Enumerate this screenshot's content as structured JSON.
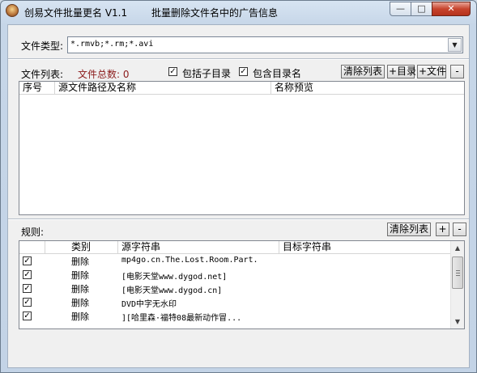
{
  "window": {
    "title": "创易文件批量更名 V1.1",
    "subtitle": "批量删除文件名中的广告信息",
    "min_label": "—",
    "max_label": "□",
    "close_label": "✕"
  },
  "filetype": {
    "label": "文件类型:",
    "value": "*.rmvb;*.rm;*.avi",
    "dropdown_glyph": "▼"
  },
  "filelist": {
    "label": "文件列表:",
    "count_label": "文件总数: 0",
    "count_color": "#8b1a1a",
    "include_subdirs": {
      "label": "包括子目录",
      "checked": true
    },
    "include_dirname": {
      "label": "包含目录名",
      "checked": true
    },
    "clear_button": "清除列表",
    "add_dir_button": "+目录",
    "add_file_button": "+文件",
    "remove_button": "-",
    "columns": [
      "序号",
      "源文件路径及名称",
      "名称预览"
    ],
    "rows": []
  },
  "rules": {
    "label": "规则:",
    "clear_button": "清除列表",
    "add_button": "+",
    "remove_button": "-",
    "columns": [
      "",
      "类别",
      "源字符串",
      "目标字符串"
    ],
    "rows": [
      {
        "checked": true,
        "category": "删除",
        "source": "mp4go.cn.The.Lost.Room.Part.",
        "target": ""
      },
      {
        "checked": true,
        "category": "删除",
        "source": "[电影天堂www.dygod.net]",
        "target": ""
      },
      {
        "checked": true,
        "category": "删除",
        "source": "[电影天堂www.dygod.cn]",
        "target": ""
      },
      {
        "checked": true,
        "category": "删除",
        "source": "DVD中字无水印",
        "target": ""
      },
      {
        "checked": true,
        "category": "删除",
        "source": "][哈里森·福特08最新动作冒...",
        "target": ""
      }
    ],
    "scroll_up": "▲",
    "scroll_down": "▼"
  },
  "check_glyph": "✓"
}
